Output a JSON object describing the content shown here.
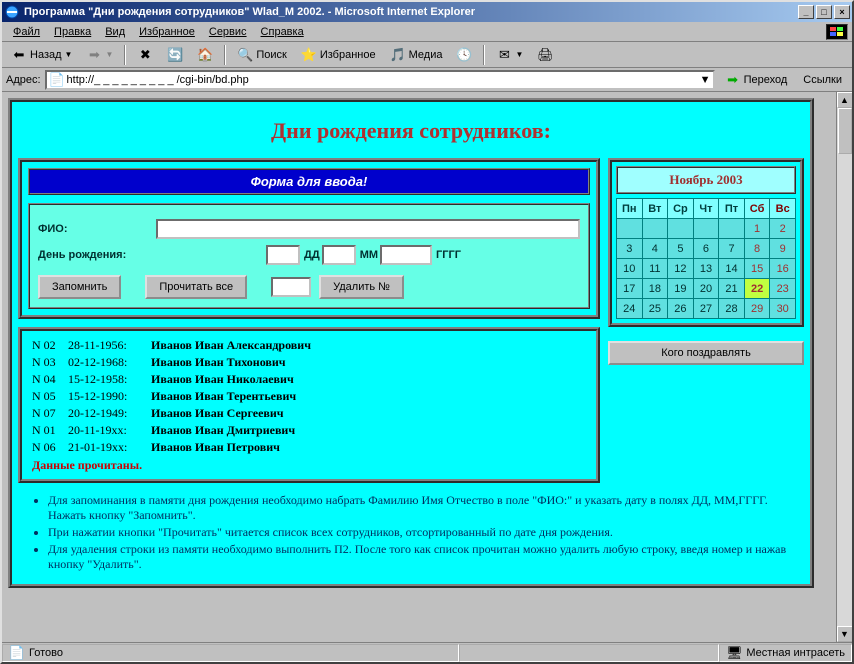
{
  "window": {
    "title": "Программа \"Дни рождения сотрудников\" Wlad_M 2002. - Microsoft Internet Explorer"
  },
  "menu": {
    "file": "Файл",
    "edit": "Правка",
    "view": "Вид",
    "favorites": "Избранное",
    "tools": "Сервис",
    "help": "Справка"
  },
  "toolbar": {
    "back": "Назад",
    "search": "Поиск",
    "favorites": "Избранное",
    "media": "Медиа"
  },
  "address": {
    "label": "Адрес:",
    "value": "http://_ _ _ _ _ _ _ _ _ /cgi-bin/bd.php",
    "go": "Переход",
    "links": "Ссылки"
  },
  "page": {
    "heading": "Дни рождения сотрудников:",
    "form_title": "Форма для ввода!",
    "fio_label": "ФИО:",
    "dob_label": "День рождения:",
    "dd": "ДД",
    "mm": "ММ",
    "yyyy": "ГГГГ",
    "btn_save": "Запомнить",
    "btn_read": "Прочитать все",
    "btn_delete": "Удалить №",
    "records": [
      {
        "n": "N 02",
        "d": "28-11-1956:",
        "name": "Иванов Иван Александрович"
      },
      {
        "n": "N 03",
        "d": "02-12-1968:",
        "name": "Иванов Иван Тихонович"
      },
      {
        "n": "N 04",
        "d": "15-12-1958:",
        "name": "Иванов Иван Николаевич"
      },
      {
        "n": "N 05",
        "d": "15-12-1990:",
        "name": "Иванов Иван Терентьевич"
      },
      {
        "n": "N 07",
        "d": "20-12-1949:",
        "name": "Иванов Иван Сергеевич"
      },
      {
        "n": "N 01",
        "d": "20-11-19xx:",
        "name": "Иванов Иван Дмитриевич"
      },
      {
        "n": "N 06",
        "d": "21-01-19xx:",
        "name": "Иванов Иван Петрович"
      }
    ],
    "records_footer": "Данные прочитаны.",
    "instructions": [
      "Для запоминания в памяти дня рождения необходимо набрать Фамилию Имя Отчество в поле \"ФИО:\" и указать дату в полях ДД, ММ,ГГГГ. Нажать кнопку \"Запомнить\".",
      "При нажатии кнопки \"Прочитать\" читается список всех сотрудников, отсортированный по дате дня рождения.",
      "Для удаления строки из памяти необходимо выполнить П2. После того как список прочитан можно удалить любую строку, введя номер и нажав кнопку \"Удалить\"."
    ],
    "btn_congr": "Кого поздравлять"
  },
  "calendar": {
    "title": "Ноябрь 2003",
    "dows": [
      "Пн",
      "Вт",
      "Ср",
      "Чт",
      "Пт",
      "Сб",
      "Вс"
    ],
    "weeks": [
      [
        "",
        "",
        "",
        "",
        "",
        1,
        2
      ],
      [
        3,
        4,
        5,
        6,
        7,
        8,
        9
      ],
      [
        10,
        11,
        12,
        13,
        14,
        15,
        16
      ],
      [
        17,
        18,
        19,
        20,
        21,
        22,
        23
      ],
      [
        24,
        25,
        26,
        27,
        28,
        29,
        30
      ]
    ],
    "today": 22
  },
  "status": {
    "ready": "Готово",
    "zone": "Местная интрасеть"
  }
}
